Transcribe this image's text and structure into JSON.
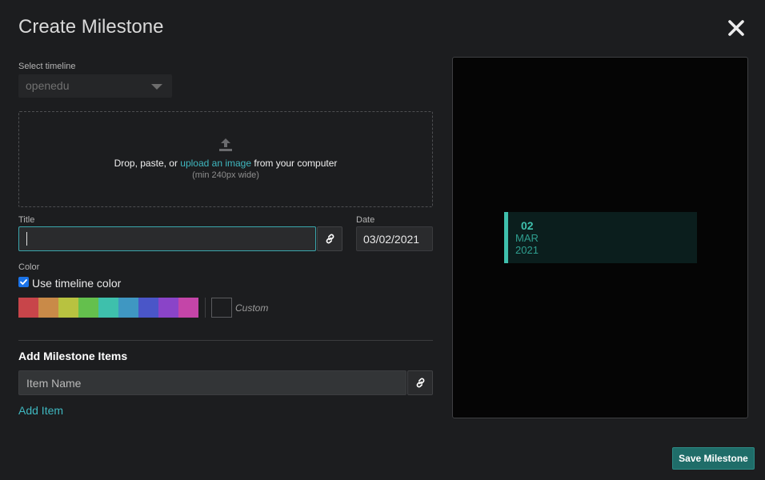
{
  "dialog": {
    "title": "Create Milestone"
  },
  "timeline": {
    "label": "Select timeline",
    "selected": "openedu"
  },
  "dropzone": {
    "prefix": "Drop, paste, or ",
    "link": "upload an image",
    "suffix": " from your computer",
    "hint": "(min 240px wide)"
  },
  "form": {
    "title_label": "Title",
    "title_value": "",
    "date_label": "Date",
    "date_value": "03/02/2021",
    "color_label": "Color",
    "use_timeline_color_label": "Use timeline color",
    "use_timeline_color_checked": true,
    "custom_label": "Custom"
  },
  "swatches": [
    "#c8454a",
    "#c98a48",
    "#b8c240",
    "#64c04d",
    "#3ec0ac",
    "#3f97c2",
    "#4a56c8",
    "#8a44c8",
    "#c445a8"
  ],
  "items": {
    "heading": "Add Milestone Items",
    "placeholder": "Item Name",
    "add_label": "Add Item"
  },
  "preview": {
    "day": "02",
    "month": "MAR",
    "year": "2021"
  },
  "actions": {
    "save_label": "Save Milestone"
  },
  "colors": {
    "accent": "#3fb8c0",
    "milestone": "#3fc0ad",
    "save": "#1f6d69",
    "checkbox": "#1a73e8"
  }
}
